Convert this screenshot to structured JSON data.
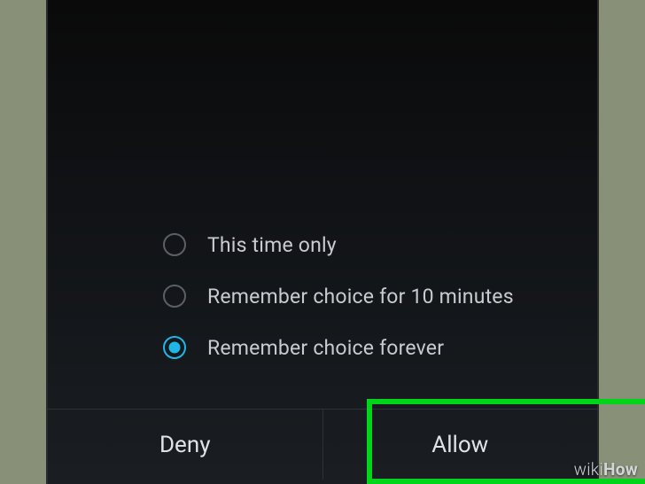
{
  "dialog": {
    "options": [
      {
        "label": "This time only",
        "selected": false
      },
      {
        "label": "Remember choice for 10 minutes",
        "selected": false
      },
      {
        "label": "Remember choice forever",
        "selected": true
      }
    ],
    "buttons": {
      "deny": "Deny",
      "allow": "Allow"
    }
  },
  "watermark": {
    "part1": "wiki",
    "part2": "How"
  }
}
